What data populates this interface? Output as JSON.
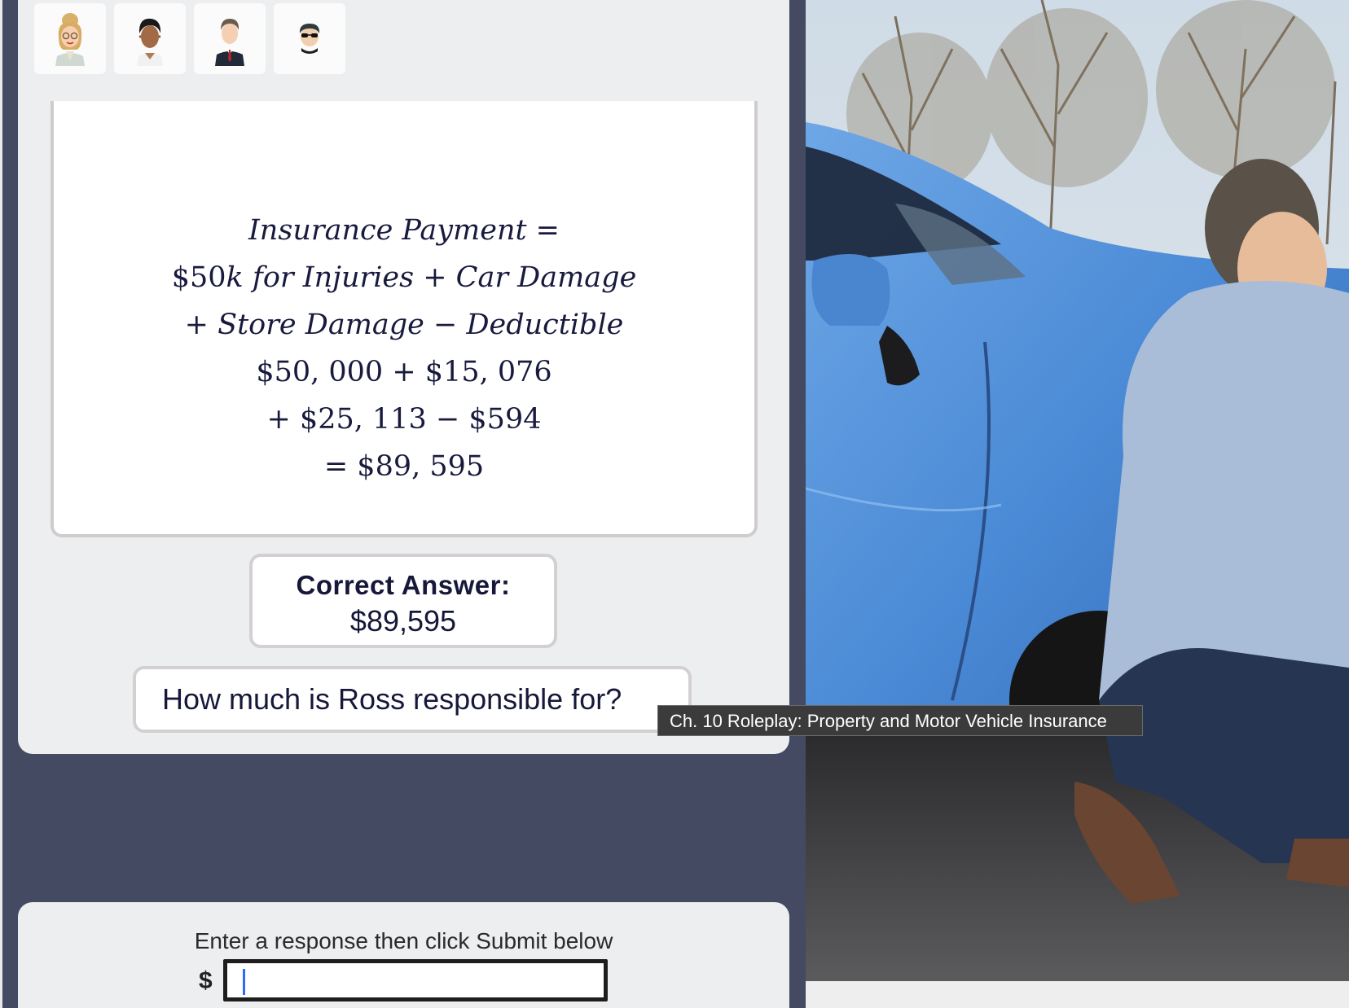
{
  "avatars": [
    {
      "name": "avatar-woman-glasses-icon"
    },
    {
      "name": "avatar-man-dark-hair-icon"
    },
    {
      "name": "avatar-man-suit-icon"
    },
    {
      "name": "avatar-man-sunglasses-icon"
    }
  ],
  "equation": {
    "line1": "Insurance Payment =",
    "line2_amount": "$50",
    "line2_k": "k",
    "line2_rest": " for Injuries + Car Damage",
    "line3": "+ Store Damage − Deductible",
    "line4": "$50, 000 + $15, 076",
    "line5": "+ $25, 113 − $594",
    "line6": "= $89, 595"
  },
  "answer": {
    "label": "Correct Answer:",
    "value": "$89,595"
  },
  "question": "How much is Ross responsible for?",
  "tooltip": "Ch. 10 Roleplay: Property and Motor Vehicle Insurance",
  "response": {
    "prompt": "Enter a response then click Submit below",
    "currency": "$",
    "input_value": "",
    "input_placeholder": ""
  },
  "colors": {
    "page_bg": "#434a62",
    "panel_bg": "#edeeef",
    "text_dark": "#16183a",
    "tooltip_bg": "#3b3b3b",
    "input_caret": "#2a6df4"
  }
}
